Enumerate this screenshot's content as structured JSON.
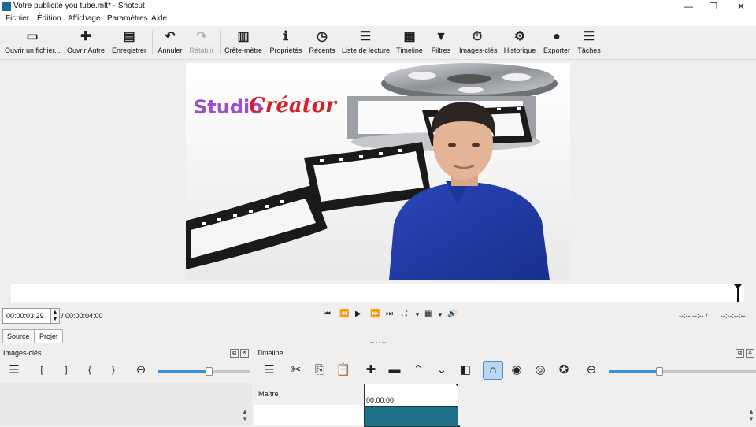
{
  "window": {
    "title": "Votre publicité you tube.mlt* - Shotcut"
  },
  "menu": [
    "Fichier",
    "Édition",
    "Affichage",
    "Paramètres",
    "Aide"
  ],
  "toolbar": [
    {
      "label": "Ouvrir un fichier...",
      "icon": "folder-open-icon",
      "glyph": "▭"
    },
    {
      "label": "Ouvrir Autre",
      "icon": "open-other-icon",
      "glyph": "✚"
    },
    {
      "label": "Enregistrer",
      "icon": "save-icon",
      "glyph": "▤"
    },
    {
      "label": "Annuler",
      "icon": "undo-icon",
      "glyph": "↶"
    },
    {
      "label": "Rétablir",
      "icon": "redo-icon",
      "glyph": "↷"
    },
    {
      "label": "Crête-mètre",
      "icon": "peak-meter-icon",
      "glyph": "▥"
    },
    {
      "label": "Propriétés",
      "icon": "properties-icon",
      "glyph": "ℹ"
    },
    {
      "label": "Récents",
      "icon": "recent-clock-icon",
      "glyph": "◷"
    },
    {
      "label": "Liste de lecture",
      "icon": "playlist-icon",
      "glyph": "☰"
    },
    {
      "label": "Timeline",
      "icon": "timeline-icon",
      "glyph": "▦"
    },
    {
      "label": "Filtres",
      "icon": "filter-funnel-icon",
      "glyph": "▼"
    },
    {
      "label": "Images-clés",
      "icon": "keyframes-stopwatch-icon",
      "glyph": "⏱"
    },
    {
      "label": "Historique",
      "icon": "history-icon",
      "glyph": "⚙"
    },
    {
      "label": "Exporter",
      "icon": "export-disc-icon",
      "glyph": "●"
    },
    {
      "label": "Tâches",
      "icon": "jobs-database-icon",
      "glyph": "☰"
    }
  ],
  "preview": {
    "brand_part1": "Studio",
    "brand_part2": "Créator"
  },
  "transport": {
    "position": "00:00:03:29",
    "duration": "/ 00:00:04:00",
    "in_point": "--:--:--:-- /",
    "out_point": "--:--:--:--"
  },
  "tabs": {
    "source": "Source",
    "project": "Projet"
  },
  "keyframes_panel": {
    "title": "Images-clés",
    "buttons": [
      "☰",
      "[",
      "]",
      "{",
      "}",
      "⊖"
    ]
  },
  "timeline_panel": {
    "title": "Timeline",
    "track_name": "Maître",
    "clip_time": "00:00:00"
  },
  "colors": {
    "accent": "#3c8ed6",
    "clip": "#1f6f86",
    "appicon": "#1d6b8f"
  }
}
